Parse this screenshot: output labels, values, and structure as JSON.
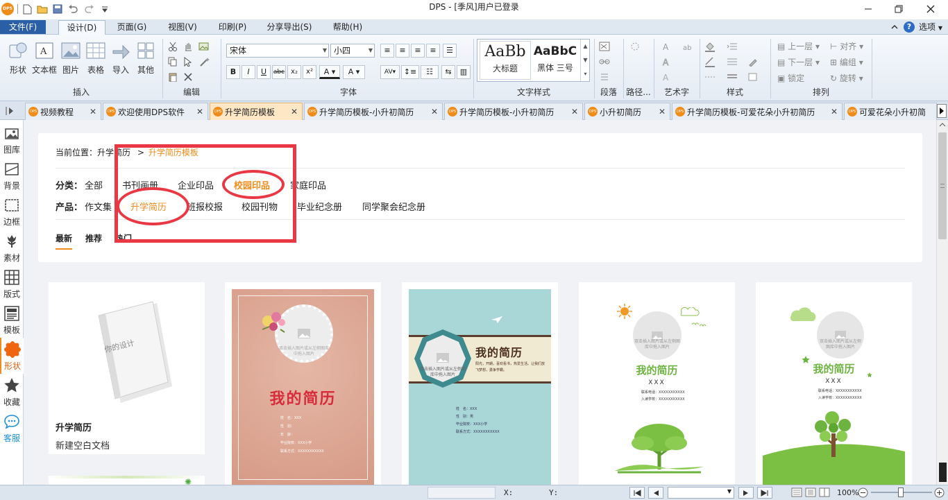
{
  "titlebar": {
    "title": "DPS - [季风]用户已登录",
    "logo": "DPS"
  },
  "menu": {
    "file": "文件(F)",
    "items": [
      "设计(D)",
      "页面(G)",
      "视图(V)",
      "印刷(P)",
      "分享导出(S)",
      "帮助(H)"
    ],
    "options": "选项"
  },
  "ribbon": {
    "insert": {
      "label": "插入",
      "buttons": [
        "形状",
        "文本框",
        "图片",
        "表格",
        "导入",
        "其他"
      ]
    },
    "edit": {
      "label": "编辑"
    },
    "font": {
      "label": "字体",
      "family": "宋体",
      "size": "小四"
    },
    "textstyle": {
      "label": "文字样式",
      "preview1": "AaBb",
      "preview1_name": "大标题",
      "preview2": "AaBbC",
      "preview2_name": "黑体 三号"
    },
    "paragraph": {
      "label": "段落"
    },
    "path": {
      "label": "路径..."
    },
    "arttext": {
      "label": "艺术字"
    },
    "style": {
      "label": "样式"
    },
    "arrange": {
      "label": "排列",
      "items": [
        "上一层",
        "对齐",
        "下一层",
        "编组",
        "锁定",
        "旋转"
      ]
    }
  },
  "tabs": [
    {
      "label": "视频教程"
    },
    {
      "label": "欢迎使用DPS软件"
    },
    {
      "label": "升学简历模板"
    },
    {
      "label": "升学简历模板-小升初简历"
    },
    {
      "label": "升学简历模板-小升初简历"
    },
    {
      "label": "小升初简历"
    },
    {
      "label": "升学简历模板-可爱花朵小升初简历"
    },
    {
      "label": "可爱花朵小升初简"
    }
  ],
  "sidebar": [
    "图库",
    "背景",
    "边框",
    "素材",
    "版式",
    "模板",
    "形状",
    "收藏",
    "客服"
  ],
  "breadcrumb": {
    "prefix": "当前位置：",
    "parent": "升学简历",
    "sep": ">",
    "current": "升学简历模板"
  },
  "category": {
    "label": "分类：",
    "items": [
      "全部",
      "书刊画册",
      "企业印品",
      "校园印品",
      "家庭印品"
    ],
    "selected": "校园印品"
  },
  "product": {
    "label": "产品：",
    "items": [
      "作文集",
      "升学简历",
      "班报校报",
      "校园刊物",
      "毕业纪念册",
      "同学聚会纪念册"
    ],
    "selected": "升学简历"
  },
  "sort": {
    "items": [
      "最新",
      "推荐",
      "热门"
    ]
  },
  "cards": {
    "blank": {
      "title": "升学简历",
      "subtitle": "新建空白文档",
      "booklet_text": "你的设计"
    },
    "t1": {
      "title": "我的简历",
      "photo_hint": "双击插入图片或从左侧图库中拖入图片",
      "fields": [
        "姓　名：XXX",
        "性　别：",
        "年　龄：",
        "毕业院校：XXX小学",
        "联系方式：XXXXXXXXXXX"
      ]
    },
    "t2": {
      "title": "我的简历",
      "photo_hint": "双击插入图片或从左侧图库中拖入图片",
      "tagline": "阳光，开朗，喜欢看书，热爱生活。让我们放飞梦想，勇争学霸。",
      "fields": [
        "姓　名：XXX",
        "性　别：男",
        "毕业院校：XXX小学",
        "联系方式：XXXXXXXXXXX"
      ]
    },
    "t3": {
      "title": "我的简历",
      "name": "XXX",
      "photo_hint": "双击插入图片或从左侧图库中拖入图片",
      "fields": [
        "联系电话：XXXXXXXXXXX",
        "入读学校：XXXXXXXXXXX"
      ]
    },
    "t4": {
      "title": "我的简历",
      "name": "XXX",
      "photo_hint": "双击插入图片或从左侧图库中拖入图片",
      "fields": [
        "联系电话：XXXXXXXXXXX",
        "入读学校：XXXXXXXXXXX"
      ]
    }
  },
  "status": {
    "x": "X:",
    "y": "Y:",
    "zoom": "100%"
  },
  "colors": {
    "accent": "#f08c1a",
    "highlight": "#e93843",
    "ribbon": "#e4ebf4"
  }
}
